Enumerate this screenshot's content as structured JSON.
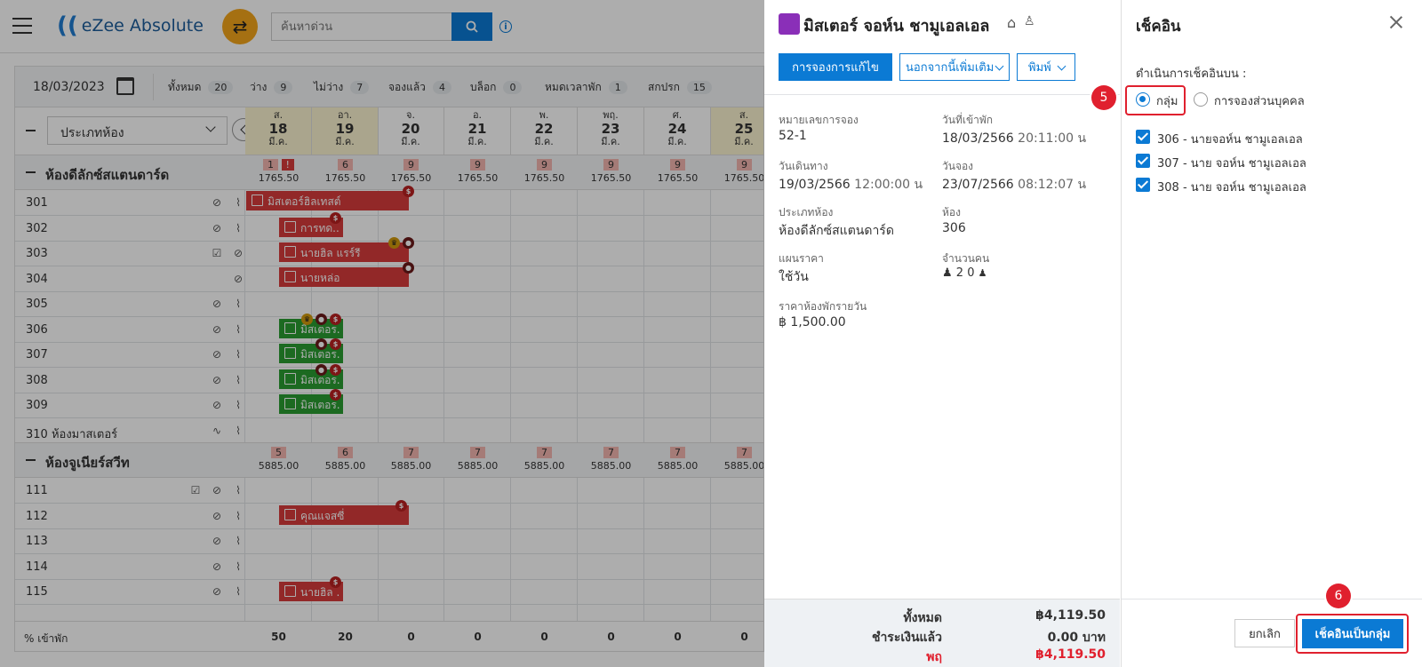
{
  "app": {
    "logo_text": "eZee Absolute",
    "search_placeholder": "ค้นหาด่วน"
  },
  "filter": {
    "date": "18/03/2023",
    "stats": [
      {
        "label": "ทั้งหมด",
        "count": "20"
      },
      {
        "label": "ว่าง",
        "count": "9"
      },
      {
        "label": "ไม่ว่าง",
        "count": "7"
      },
      {
        "label": "จองแล้ว",
        "count": "4"
      },
      {
        "label": "บล็อก",
        "count": "0"
      },
      {
        "label": "หมดเวลาพัก",
        "count": "1"
      },
      {
        "label": "สกปรก",
        "count": "15"
      }
    ]
  },
  "room_type_select": "ประเภทห้อง",
  "days": [
    {
      "dow": "ส.",
      "day": "18",
      "mon": "มี.ค.",
      "weekend": true
    },
    {
      "dow": "อา.",
      "day": "19",
      "mon": "มี.ค.",
      "weekend": true
    },
    {
      "dow": "จ.",
      "day": "20",
      "mon": "มี.ค.",
      "weekend": false
    },
    {
      "dow": "อ.",
      "day": "21",
      "mon": "มี.ค.",
      "weekend": false
    },
    {
      "dow": "พ.",
      "day": "22",
      "mon": "มี.ค.",
      "weekend": false
    },
    {
      "dow": "พฤ.",
      "day": "23",
      "mon": "มี.ค.",
      "weekend": false
    },
    {
      "dow": "ศ.",
      "day": "24",
      "mon": "มี.ค.",
      "weekend": false
    },
    {
      "dow": "ส.",
      "day": "25",
      "mon": "มี.ค.",
      "weekend": true
    }
  ],
  "sections": [
    {
      "title": "ห้องดีลักซ์สแตนดาร์ด",
      "avail": [
        "1",
        "6",
        "9",
        "9",
        "9",
        "9",
        "9",
        "9"
      ],
      "alert": "!",
      "rate": [
        "1765.50",
        "1765.50",
        "1765.50",
        "1765.50",
        "1765.50",
        "1765.50",
        "1765.50",
        "1765.50"
      ]
    },
    {
      "title": "ห้องจูเนียร์สวีท",
      "avail": [
        "5",
        "6",
        "7",
        "7",
        "7",
        "7",
        "7",
        "7"
      ],
      "rate": [
        "5885.00",
        "5885.00",
        "5885.00",
        "5885.00",
        "5885.00",
        "5885.00",
        "5885.00",
        "5885.00"
      ]
    }
  ],
  "rooms_a": [
    "301",
    "302",
    "303",
    "304",
    "305",
    "306",
    "307",
    "308",
    "309",
    "310 ห้องมาสเตอร์"
  ],
  "rooms_b": [
    "111",
    "112",
    "113",
    "114",
    "115"
  ],
  "bookings": {
    "b301": "มิสเตอร์ฮิลเทสต์",
    "b302": "การทด...",
    "b303": "นายฮิล แรร์รี",
    "b304": "นายหล่อ",
    "b306": "มิสเตอร...",
    "b307": "มิสเตอร...",
    "b308": "มิสเตอร...",
    "b309": "มิสเตอร...",
    "b112": "คุณแจสซี่",
    "b115": "นายฮิล ..."
  },
  "tag_s": "$",
  "occupancy": {
    "label": "% เข้าพัก",
    "values": [
      "50",
      "20",
      "0",
      "0",
      "0",
      "0",
      "0",
      "0"
    ]
  },
  "drawer": {
    "title": "มิสเตอร์ จอห์น ชามูเอลเอล",
    "btn_edit": "การจองการแก้ไข",
    "btn_more": "นอกจากนี้เพิ่มเติม",
    "btn_print": "พิมพ์",
    "fields": {
      "res_no_l": "หมายเลขการจอง",
      "res_no": "52-1",
      "arrival_l": "วันที่เข้าพัก",
      "arrival_d": "18/03/2566",
      "arrival_t": "20:11:00 น",
      "depart_l": "วันเดินทาง",
      "depart_d": "19/03/2566",
      "depart_t": "12:00:00 น",
      "booked_l": "วันจอง",
      "booked_d": "23/07/2566",
      "booked_t": "08:12:07 น",
      "rtype_l": "ประเภทห้อง",
      "rtype": "ห้องดีลักซ์สแตนดาร์ด",
      "room_l": "ห้อง",
      "room": "306",
      "plan_l": "แผนราคา",
      "plan": "ใช้วัน",
      "pax_l": "จำนวนคน",
      "adults": "2",
      "children": "0",
      "rate_l": "ราคาห้องพักรายวัน",
      "rate": "฿ 1,500.00"
    },
    "totals": {
      "total_l": "ทั้งหมด",
      "total": "฿4,119.50",
      "paid_l": "ชำระเงินแล้ว",
      "paid": "0.00 บาท",
      "due_l": "พฤ",
      "due": "฿4,119.50"
    }
  },
  "checkin": {
    "title": "เช็คอิน",
    "perform_label": "ดำเนินการเช็คอินบน :",
    "opt_group": "กลุ่ม",
    "opt_individual": "การจองส่วนบุคคล",
    "rooms": [
      "306 - นายจอห์น ชามูเอลเอล",
      "307 - นาย จอห์น ชามูเอลเอล",
      "308 - นาย จอห์น ชามูเอลเอล"
    ],
    "cancel": "ยกเลิก",
    "submit": "เช็คอินเป็นกลุ่ม",
    "step5": "5",
    "step6": "6"
  },
  "colors": {
    "accent": "#0b7ad4",
    "booking_red": "#d73b3b",
    "booking_green": "#2a9d32",
    "highlight": "#e0202e"
  }
}
